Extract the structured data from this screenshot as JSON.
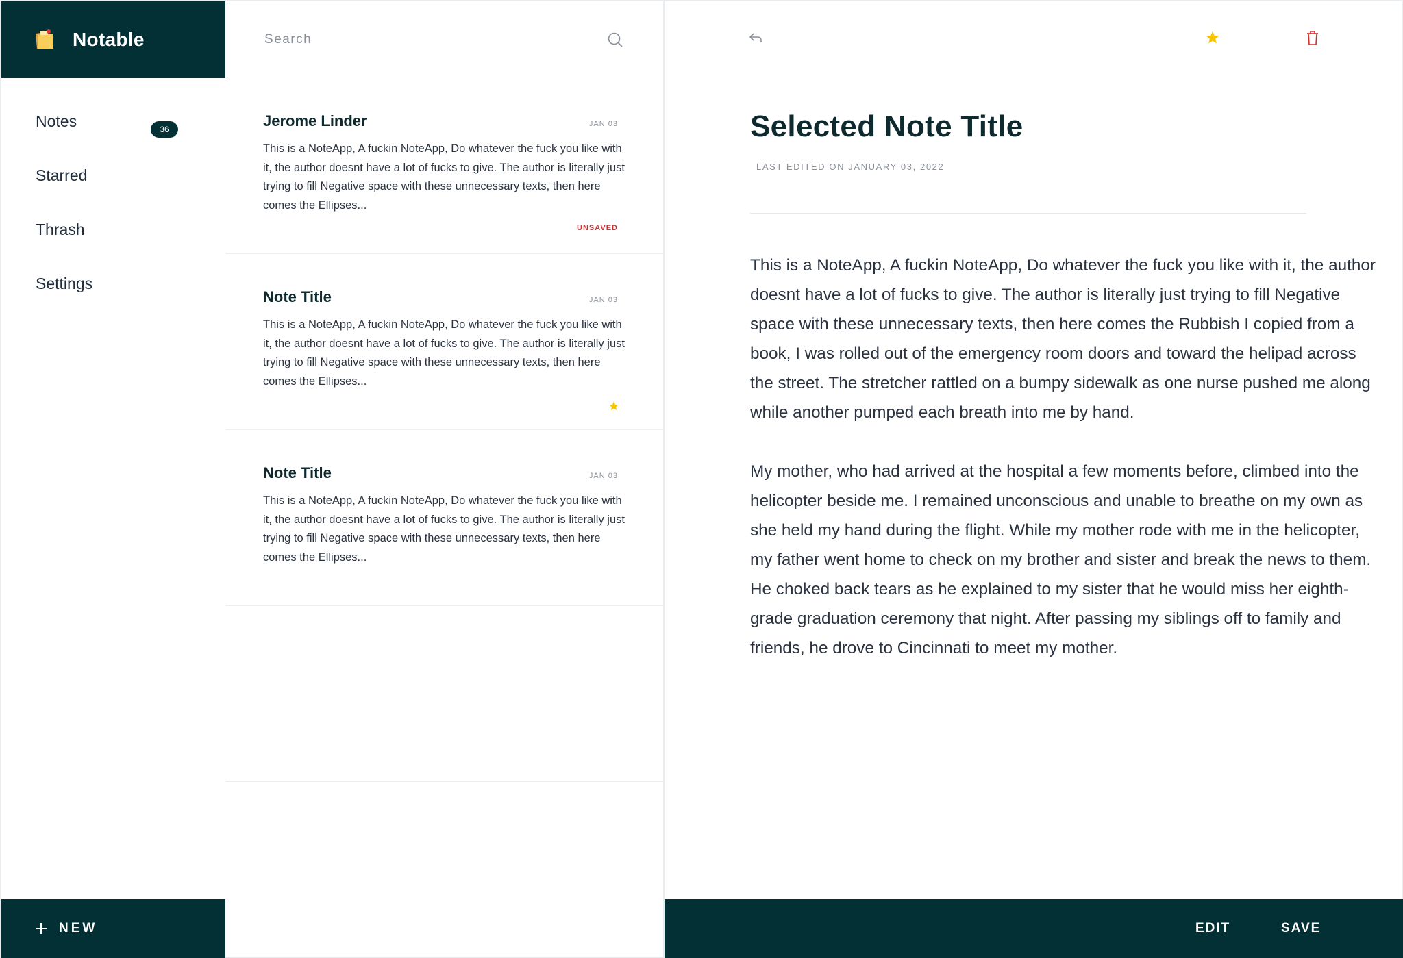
{
  "app": {
    "name": "Notable"
  },
  "sidebar": {
    "items": [
      {
        "label": "Notes",
        "badge": "36"
      },
      {
        "label": "Starred"
      },
      {
        "label": "Thrash"
      },
      {
        "label": "Settings"
      }
    ],
    "new_label": "NEW"
  },
  "search": {
    "placeholder": "Search"
  },
  "notes": [
    {
      "title": "Jerome Linder",
      "date": "JAN 03",
      "excerpt": "This is a NoteApp, A fuckin NoteApp, Do whatever the fuck you like with it, the author doesnt have a lot of fucks to give. The author is literally just trying to fill Negative space with these unnecessary texts, then here comes the Ellipses...",
      "status": "UNSAVED"
    },
    {
      "title": "Note Title",
      "date": "JAN 03",
      "excerpt": "This is a NoteApp, A fuckin NoteApp, Do whatever the fuck you like with it, the author doesnt have a lot of fucks to give. The author is literally just trying to fill Negative space with these unnecessary texts, then here comes the Ellipses...",
      "starred": true
    },
    {
      "title": "Note Title",
      "date": "JAN 03",
      "excerpt": "This is a NoteApp, A fuckin NoteApp, Do whatever the fuck you like with it, the author doesnt have a lot of fucks to give. The author is literally just trying to fill Negative space with these unnecessary texts, then here comes the Ellipses..."
    }
  ],
  "editor": {
    "title": "Selected Note Title",
    "last_edited": "LAST EDITED ON JANUARY 03, 2022",
    "paragraphs": [
      "This is a NoteApp, A fuckin NoteApp, Do whatever the fuck you like with it, the author doesnt have a lot of fucks to give. The author is literally just trying to fill Negative space with these unnecessary texts, then here comes the Rubbish I copied from a book, I was rolled out of the emergency room doors and toward the helipad across the street. The stretcher rattled on a bumpy sidewalk as one nurse pushed me along while another pumped each breath into me by hand.",
      "My mother, who had arrived at the hospital a few moments before, climbed into the helicopter beside me. I remained unconscious and unable to breathe on my own as she held my hand during the flight. While my mother rode with me in the helicopter, my father went home to check on my brother and sister and break the news to them. He choked back tears as he explained to my sister that he would miss her eighth-grade graduation ceremony that night. After passing my siblings off to family and friends, he drove to Cincinnati to meet my mother."
    ],
    "edit_label": "EDIT",
    "save_label": "SAVE"
  },
  "colors": {
    "primary": "#023035",
    "star": "#f5c400",
    "danger": "#d32f2f"
  },
  "icons": [
    "notes-logo-icon",
    "plus-icon",
    "search-icon",
    "back-icon",
    "star-icon",
    "trash-icon"
  ]
}
